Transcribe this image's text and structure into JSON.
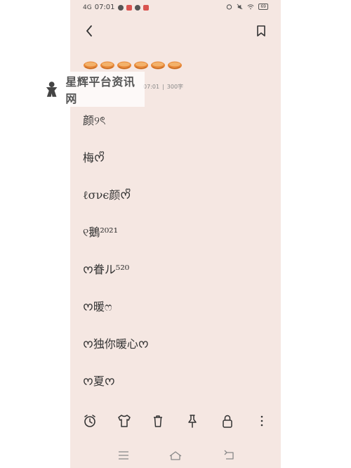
{
  "status_bar": {
    "network": "4G",
    "time": "07:01",
    "battery": "69"
  },
  "note": {
    "meta_time": "07:01",
    "meta_separator": "|",
    "meta_count": "300字",
    "lines": [
      "颜୨ৎ",
      "梅ᰔᩚ",
      "ℓσνє颜ᰔᩚ",
      "୧鵝²⁰²¹",
      "ᰔ眷ル⁵²⁰",
      "ᰔ暖ෆ",
      "ᰔ独你暖心ᰔ",
      "ᰔ夏ᰔ"
    ]
  },
  "watermark": {
    "text": "星辉平台资讯网"
  },
  "colors": {
    "background": "#f5e7e2",
    "bowl": "#e8893a"
  }
}
